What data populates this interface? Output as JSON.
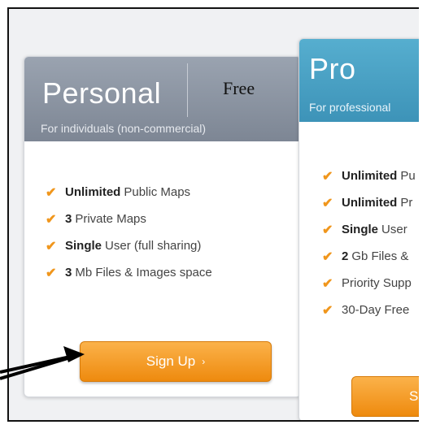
{
  "personal": {
    "name": "Personal",
    "price": "Free",
    "subtitle": "For individuals (non-commercial)",
    "features": [
      {
        "bold": "Unlimited",
        "text": "Public Maps"
      },
      {
        "bold": "3",
        "text": "Private Maps"
      },
      {
        "bold": "Single",
        "text": "User (full sharing)"
      },
      {
        "bold": "3",
        "text": "Mb Files & Images space"
      }
    ],
    "signup_label": "Sign Up",
    "signup_arrow": "›"
  },
  "pro": {
    "name": "Pro",
    "subtitle": "For professional",
    "features": [
      {
        "bold": "Unlimited",
        "text": "Pu"
      },
      {
        "bold": "Unlimited",
        "text": "Pr"
      },
      {
        "bold": "Single",
        "text": "User"
      },
      {
        "bold": "2",
        "text": "Gb Files &"
      },
      {
        "bold": "",
        "text": "Priority Supp"
      },
      {
        "bold": "",
        "text": "30-Day Free"
      }
    ],
    "signup_label": "SI"
  },
  "colors": {
    "personal_header": "#8b93a0",
    "pro_header": "#4aa3c6",
    "check": "#f0961c",
    "button": "#f59b1f"
  },
  "icons": [
    "check-icon",
    "chevron-right-icon",
    "pointer-arrow-icon"
  ]
}
